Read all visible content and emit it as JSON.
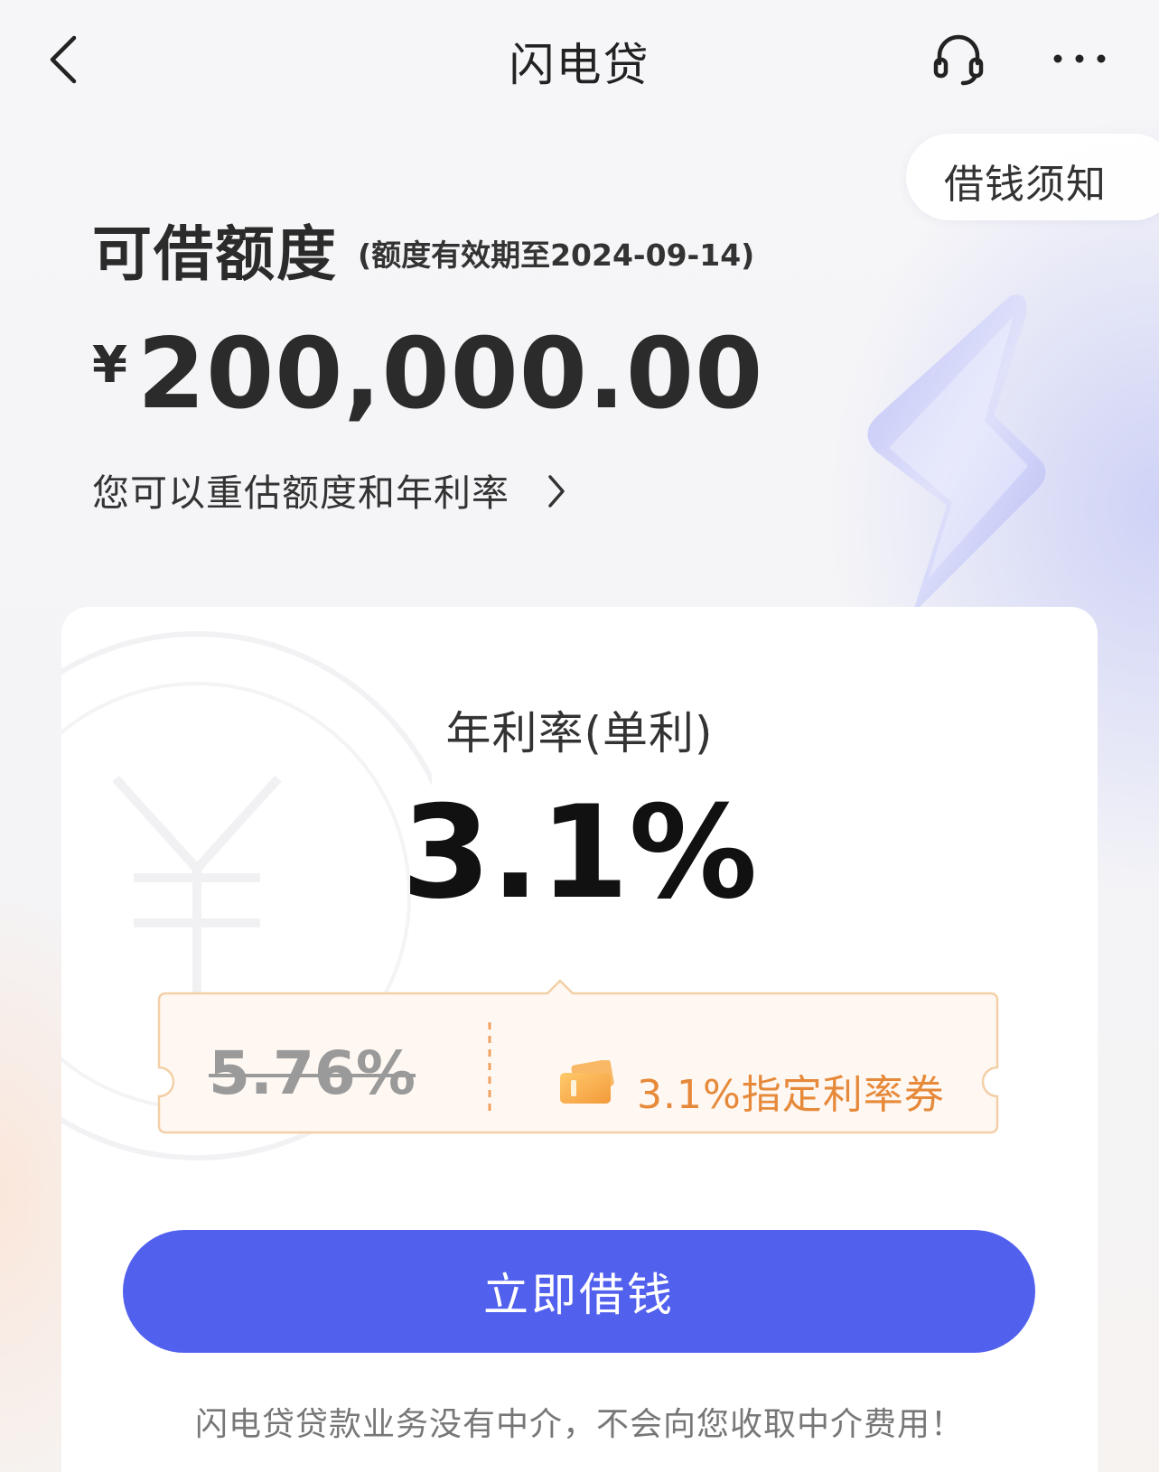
{
  "nav": {
    "title": "闪电贷",
    "notice_label": "借钱须知"
  },
  "limit": {
    "title": "可借额度",
    "expiry": "(额度有效期至2024-09-14)",
    "currency_symbol": "¥",
    "amount": "200,000.00",
    "reassess_link": "您可以重估额度和年利率"
  },
  "rate": {
    "label": "年利率(单利)",
    "value": "3.1%",
    "original_rate": "5.76%",
    "coupon_label": "3.1%指定利率券"
  },
  "action": {
    "borrow_label": "立即借钱",
    "disclaimer": "闪电贷贷款业务没有中介，不会向您收取中介费用！"
  },
  "colors": {
    "primary": "#5260ee",
    "coupon_accent": "#e6893a",
    "coupon_border": "#f3cfa8",
    "coupon_bg": "#fff8f2"
  },
  "icons": {
    "back": "chevron-left-icon",
    "support": "headset-icon",
    "more": "more-dots-icon",
    "link_arrow": "chevron-right-icon",
    "coupon": "ticket-icon",
    "decoration": "lightning-bolt-icon"
  }
}
